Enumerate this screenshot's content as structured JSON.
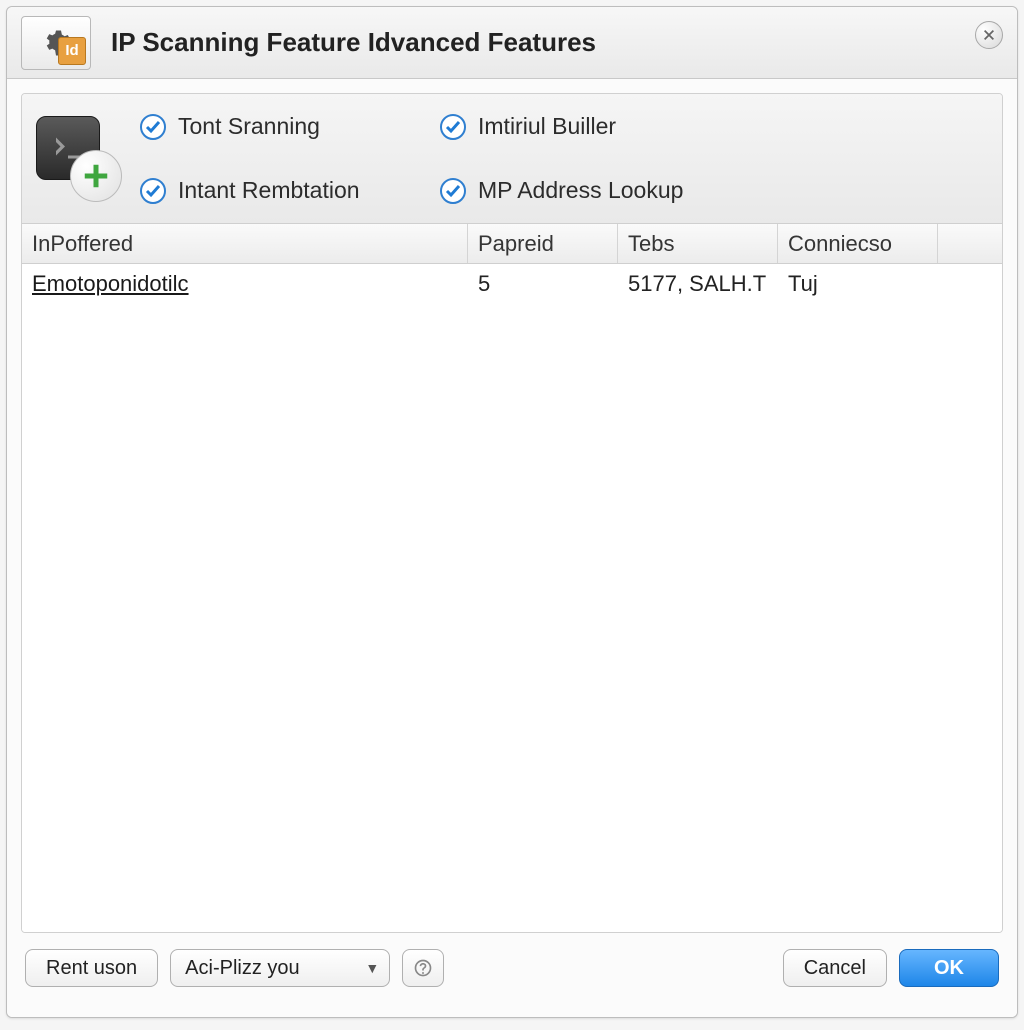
{
  "title": "IP Scanning Feature Idvanced Features",
  "title_badge": "Id",
  "checkboxes": [
    {
      "label": "Tont Sranning",
      "checked": true
    },
    {
      "label": "Imtiriul Builler",
      "checked": true
    },
    {
      "label": "Intant Rembtation",
      "checked": true
    },
    {
      "label": "MP Address Lookup",
      "checked": true
    }
  ],
  "table": {
    "columns": [
      "InPoffered",
      "Papreid",
      "Tebs",
      "Conniecso"
    ],
    "rows": [
      {
        "name": "Emotoponidotilc",
        "papreid": "5",
        "tebs": "5177, SALH.T",
        "conniecso": "Tuj"
      }
    ]
  },
  "footer": {
    "rent_button": "Rent uson",
    "select_value": "Aci-Plizz you",
    "cancel": "Cancel",
    "ok": "OK"
  }
}
